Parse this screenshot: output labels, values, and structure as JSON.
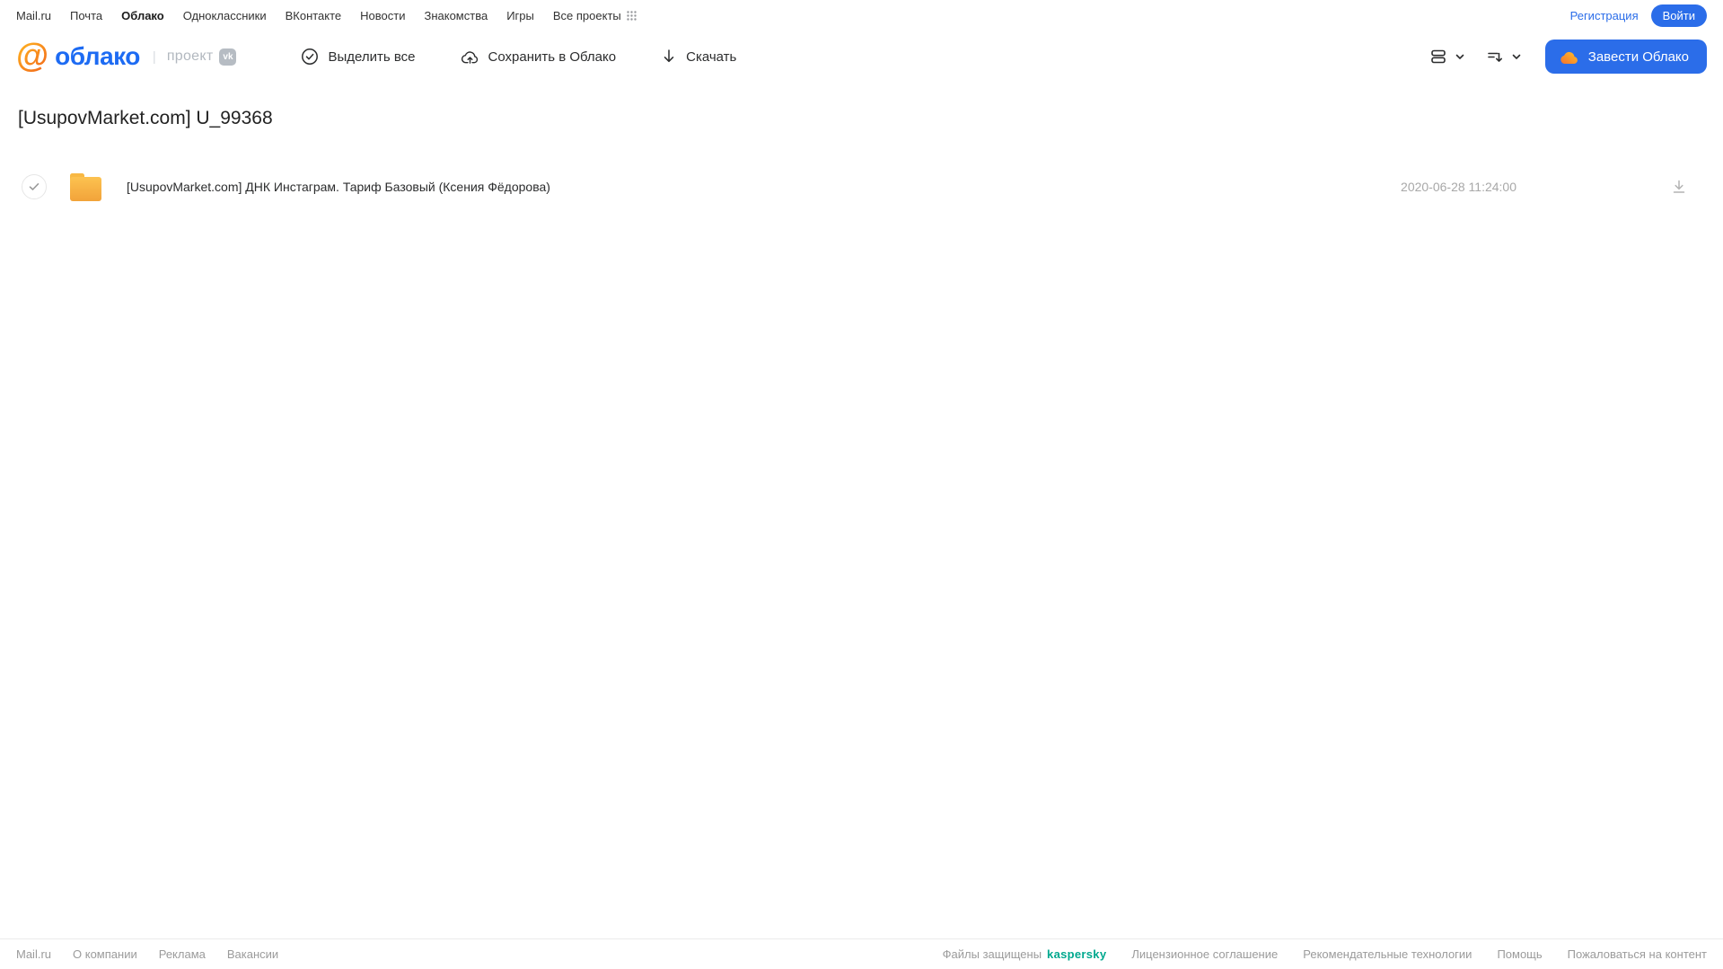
{
  "topbar": {
    "links": [
      "Mail.ru",
      "Почта",
      "Облако",
      "Одноклассники",
      "ВКонтакте",
      "Новости",
      "Знакомства",
      "Игры",
      "Все проекты"
    ],
    "active_link": "Облако",
    "registration_label": "Регистрация",
    "login_label": "Войти"
  },
  "header": {
    "logo_at": "@",
    "logo_text": "облако",
    "project_divider": "|",
    "project_label": "проект",
    "vk_badge": "vk",
    "toolbar": {
      "select_all_label": "Выделить все",
      "save_to_cloud_label": "Сохранить в Облако",
      "download_label": "Скачать"
    },
    "get_cloud_button_label": "Завести Облако"
  },
  "main": {
    "title": "[UsupovMarket.com] U_99368",
    "files": [
      {
        "name": "[UsupovMarket.com] ДНК Инстаграм. Тариф Базовый (Ксения Фёдорова)",
        "date": "2020-06-28 11:24:00"
      }
    ]
  },
  "footer": {
    "left_links": [
      "Mail.ru",
      "О компании",
      "Реклама",
      "Вакансии"
    ],
    "protected_label": "Файлы защищены",
    "kaspersky_label": "kaspersky",
    "right_links": [
      "Лицензионное соглашение",
      "Рекомендательные технологии",
      "Помощь",
      "Пожаловаться на контент"
    ]
  },
  "colors": {
    "accent_blue": "#2b6de9",
    "logo_blue": "#1d6bf3",
    "logo_orange": "#f7861c",
    "folder_orange": "#f5a93a",
    "kaspersky_green": "#00a88e"
  }
}
